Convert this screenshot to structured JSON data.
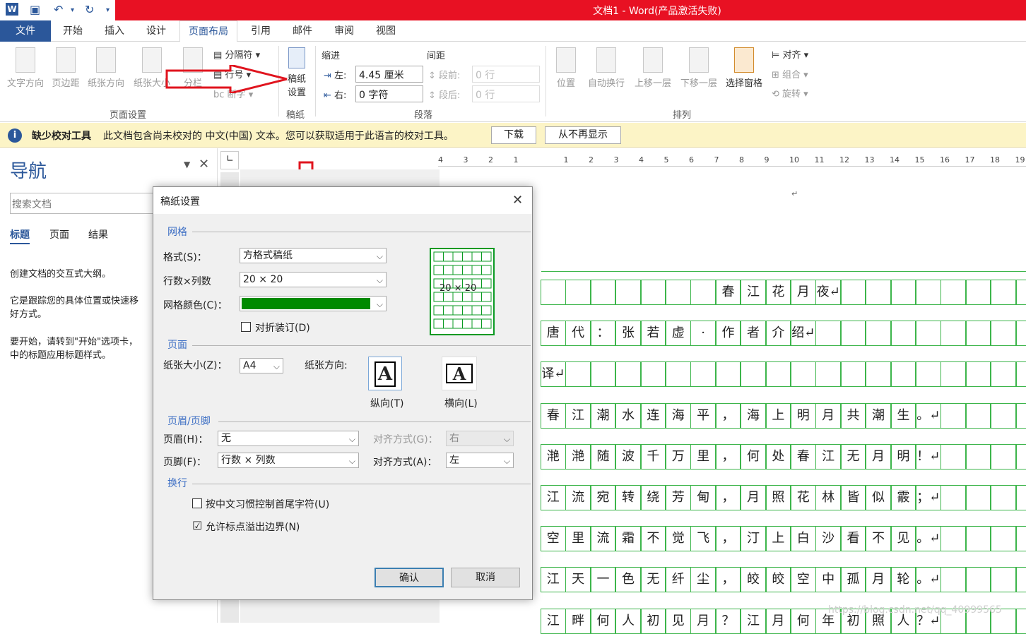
{
  "window": {
    "title": "文档1 - Word(产品激活失败)"
  },
  "menu": {
    "file": "文件",
    "tabs": [
      "开始",
      "插入",
      "设计",
      "页面布局",
      "引用",
      "邮件",
      "审阅",
      "视图"
    ]
  },
  "ribbon": {
    "page_setup": {
      "text_direction": "文字方向",
      "margins": "页边距",
      "orientation": "纸张方向",
      "size": "纸张大小",
      "columns": "分栏",
      "breaks": "分隔符",
      "line_numbers": "行号",
      "hyphenation": "断字",
      "group": "页面设置"
    },
    "manuscript": {
      "label_line1": "稿纸",
      "label_line2": "设置",
      "group": "稿纸"
    },
    "paragraph": {
      "indent": "缩进",
      "spacing": "间距",
      "left_label": "左:",
      "left_value": "4.45 厘米",
      "right_label": "右:",
      "right_value": "0 字符",
      "before_label": "段前:",
      "before_value": "0 行",
      "after_label": "段后:",
      "after_value": "0 行",
      "group": "段落"
    },
    "arrange": {
      "position": "位置",
      "wrap": "自动换行",
      "forward": "上移一层",
      "backward": "下移一层",
      "selection_pane": "选择窗格",
      "align": "对齐",
      "group_btn": "组合",
      "rotate": "旋转",
      "group": "排列"
    }
  },
  "infobar": {
    "title": "缺少校对工具",
    "message": "此文档包含尚未校对的 中文(中国) 文本。您可以获取适用于此语言的校对工具。",
    "download": "下载",
    "dont_show": "从不再显示"
  },
  "nav": {
    "title": "导航",
    "search_placeholder": "搜索文档",
    "tabs": [
      "标题",
      "页面",
      "结果"
    ],
    "p1": "创建文档的交互式大纲。",
    "p2a": "它是跟踪您的具体位置或快速移",
    "p2b": "好方式。",
    "p3a": "要开始，请转到\"开始\"选项卡，",
    "p3b": "中的标题应用标题样式。"
  },
  "ruler": {
    "ticks": [
      "4",
      "3",
      "2",
      "1",
      "",
      "1",
      "2",
      "3",
      "4",
      "5",
      "6",
      "7",
      "8",
      "9",
      "10",
      "11",
      "12",
      "13",
      "14",
      "15",
      "16",
      "17",
      "18",
      "19"
    ]
  },
  "document": {
    "rows": [
      [
        "",
        "",
        "",
        "",
        "",
        "",
        "",
        "春",
        "江",
        "花",
        "月",
        "夜↵",
        "",
        "",
        "",
        "",
        "",
        "",
        "",
        ""
      ],
      [
        "唐",
        "代",
        "：",
        "张",
        "若",
        "虚",
        "·",
        "作",
        "者",
        "介",
        "绍↵",
        "",
        "",
        "",
        "",
        "",
        "",
        "",
        "",
        ""
      ],
      [
        "译↵",
        "",
        "",
        "",
        "",
        "",
        "",
        "",
        "",
        "",
        "",
        "",
        "",
        "",
        "",
        "",
        "",
        "",
        "",
        ""
      ],
      [
        "春",
        "江",
        "潮",
        "水",
        "连",
        "海",
        "平",
        "，",
        "海",
        "上",
        "明",
        "月",
        "共",
        "潮",
        "生",
        "。↵",
        "",
        "",
        "",
        ""
      ],
      [
        "滟",
        "滟",
        "随",
        "波",
        "千",
        "万",
        "里",
        "，",
        "何",
        "处",
        "春",
        "江",
        "无",
        "月",
        "明",
        "！↵",
        "",
        "",
        "",
        ""
      ],
      [
        "江",
        "流",
        "宛",
        "转",
        "绕",
        "芳",
        "甸",
        "，",
        "月",
        "照",
        "花",
        "林",
        "皆",
        "似",
        "霰",
        "；↵",
        "",
        "",
        "",
        ""
      ],
      [
        "空",
        "里",
        "流",
        "霜",
        "不",
        "觉",
        "飞",
        "，",
        "汀",
        "上",
        "白",
        "沙",
        "看",
        "不",
        "见",
        "。↵",
        "",
        "",
        "",
        ""
      ],
      [
        "江",
        "天",
        "一",
        "色",
        "无",
        "纤",
        "尘",
        "，",
        "皎",
        "皎",
        "空",
        "中",
        "孤",
        "月",
        "轮",
        "。↵",
        "",
        "",
        "",
        ""
      ],
      [
        "江",
        "畔",
        "何",
        "人",
        "初",
        "见",
        "月",
        "？",
        "江",
        "月",
        "何",
        "年",
        "初",
        "照",
        "人",
        "？↵",
        "",
        "",
        "",
        ""
      ]
    ],
    "watermark": "https://blog.csdn.net/qq_40999565"
  },
  "dialog": {
    "title": "稿纸设置",
    "sec_grid": "网格",
    "format_label": "格式(S)：",
    "format_value": "方格式稿纸",
    "rowscols_label": "行数×列数",
    "rowscols_value": "20  ×  20",
    "color_label": "网格颜色(C)：",
    "grid_color": "#008a00",
    "fold_label": "对折装订(D)",
    "preview_text": "20 × 20",
    "sec_page": "页面",
    "size_label": "纸张大小(Z)：",
    "size_value": "A4",
    "orient_label": "纸张方向:",
    "portrait": "纵向(T)",
    "landscape": "横向(L)",
    "sec_header": "页眉/页脚",
    "header_label": "页眉(H)：",
    "header_value": "无",
    "header_align_label": "对齐方式(G)：",
    "header_align_value": "右",
    "footer_label": "页脚(F)：",
    "footer_value": "行数 × 列数",
    "footer_align_label": "对齐方式(A)：",
    "footer_align_value": "左",
    "sec_wrap": "换行",
    "opt1": "按中文习惯控制首尾字符(U)",
    "opt2": "允许标点溢出边界(N)",
    "opt2_checked": "☑",
    "ok": "确认",
    "cancel": "取消"
  }
}
